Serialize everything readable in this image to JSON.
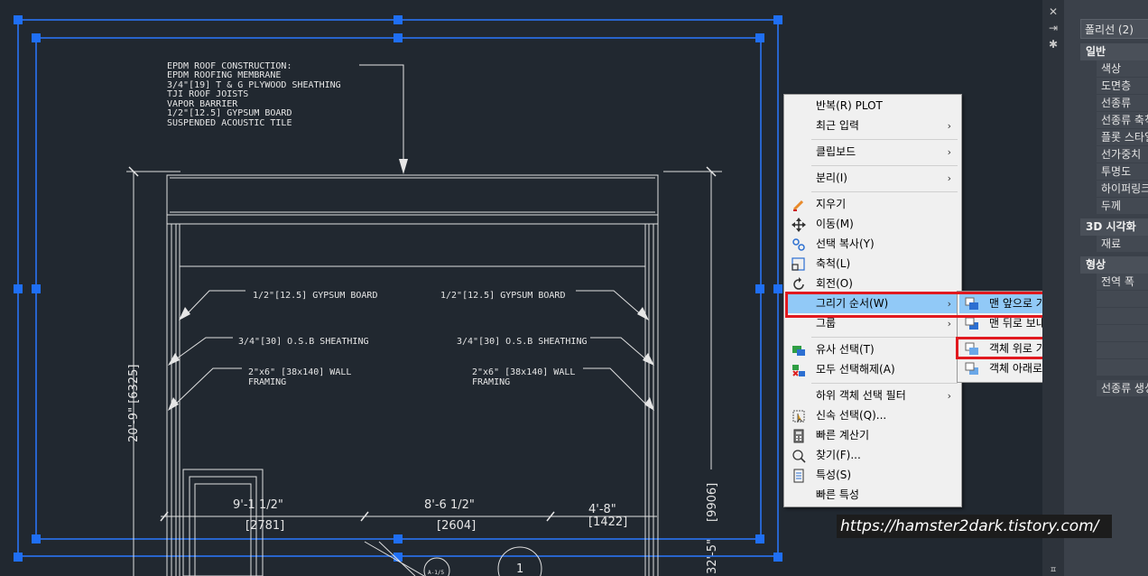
{
  "drawing": {
    "roof_notes": [
      "EPDM ROOF CONSTRUCTION:",
      "EPDM ROOFING MEMBRANE",
      "3/4\"[19] T & G PLYWOOD SHEATHING",
      "TJI ROOF JOISTS",
      "VAPOR BARRIER",
      "1/2\"[12.5] GYPSUM BOARD",
      "SUSPENDED ACOUSTIC TILE"
    ],
    "left_gypsum": "1/2\"[12.5] GYPSUM BOARD",
    "right_gypsum": "1/2\"[12.5] GYPSUM BOARD",
    "left_osb": "3/4\"[30] O.S.B SHEATHING",
    "right_osb": "3/4\"[30] O.S.B SHEATHING",
    "left_wall_1": "2\"x6\" [38x140] WALL",
    "left_wall_2": "FRAMING",
    "right_wall_1": "2\"x6\" [38x140] WALL",
    "right_wall_2": "FRAMING",
    "dim_left_v": "20'-9\" [6325]",
    "dim_right_v": "[9906]",
    "dim_right_v2": "32'-5\"",
    "dim_a": "9'-1 1/2\"",
    "dim_a_mm": "[2781]",
    "dim_b": "8'-6 1/2\"",
    "dim_b_mm": "[2604]",
    "dim_c": "4'-8\"",
    "dim_c_mm": "[1422]",
    "circle_label": "1",
    "small_label": "A-1/5"
  },
  "context_menu": {
    "items": [
      {
        "label": "반복(R) PLOT",
        "submenu": false
      },
      {
        "label": "최근 입력",
        "submenu": true
      },
      {
        "label": "클립보드",
        "submenu": true
      },
      {
        "label": "분리(I)",
        "submenu": true
      },
      {
        "label": "지우기",
        "submenu": false,
        "icon": "eraser-icon"
      },
      {
        "label": "이동(M)",
        "submenu": false,
        "icon": "move-icon"
      },
      {
        "label": "선택 복사(Y)",
        "submenu": false,
        "icon": "copy-icon"
      },
      {
        "label": "축척(L)",
        "submenu": false,
        "icon": "scale-icon"
      },
      {
        "label": "회전(O)",
        "submenu": false,
        "icon": "rotate-icon"
      },
      {
        "label": "그리기 순서(W)",
        "submenu": true,
        "highlighted": true
      },
      {
        "label": "그룹",
        "submenu": true
      },
      {
        "label": "유사 선택(T)",
        "submenu": false,
        "icon": "select-similar-icon"
      },
      {
        "label": "모두 선택해제(A)",
        "submenu": false,
        "icon": "deselect-icon"
      },
      {
        "label": "하위 객체 선택 필터",
        "submenu": true
      },
      {
        "label": "신속 선택(Q)...",
        "submenu": false,
        "icon": "quick-select-icon"
      },
      {
        "label": "빠른 계산기",
        "submenu": false,
        "icon": "calculator-icon"
      },
      {
        "label": "찾기(F)...",
        "submenu": false,
        "icon": "find-icon"
      },
      {
        "label": "특성(S)",
        "submenu": false,
        "icon": "properties-icon"
      },
      {
        "label": "빠른 특성",
        "submenu": false
      }
    ]
  },
  "submenu": {
    "items": [
      {
        "label": "맨 앞으로 가져오기(F)",
        "highlighted": true
      },
      {
        "label": "맨 뒤로 보내기(B)"
      },
      {
        "label": "객체 위로 가져오기(A)"
      },
      {
        "label": "객체 아래로 보내기(U)"
      }
    ]
  },
  "palette": {
    "selection": "폴리선 (2)",
    "sections": [
      {
        "title": "일반",
        "rows": [
          "색상",
          "도면층",
          "선종류",
          "선종류 축척",
          "플롯 스타일",
          "선가중치",
          "투명도",
          "하이퍼링크",
          "두께"
        ]
      },
      {
        "title": "3D 시각화",
        "rows": [
          "재료"
        ]
      },
      {
        "title": "형상",
        "rows": [
          "전역 폭"
        ]
      }
    ],
    "extra_row": "선종류 생성"
  },
  "watermark": "https://hamster2dark.tistory.com/",
  "colors": {
    "canvas_bg": "#212830",
    "selection_blue": "#1f6ff5",
    "highlight": "#91c9f7",
    "red_box": "#e1191f"
  }
}
